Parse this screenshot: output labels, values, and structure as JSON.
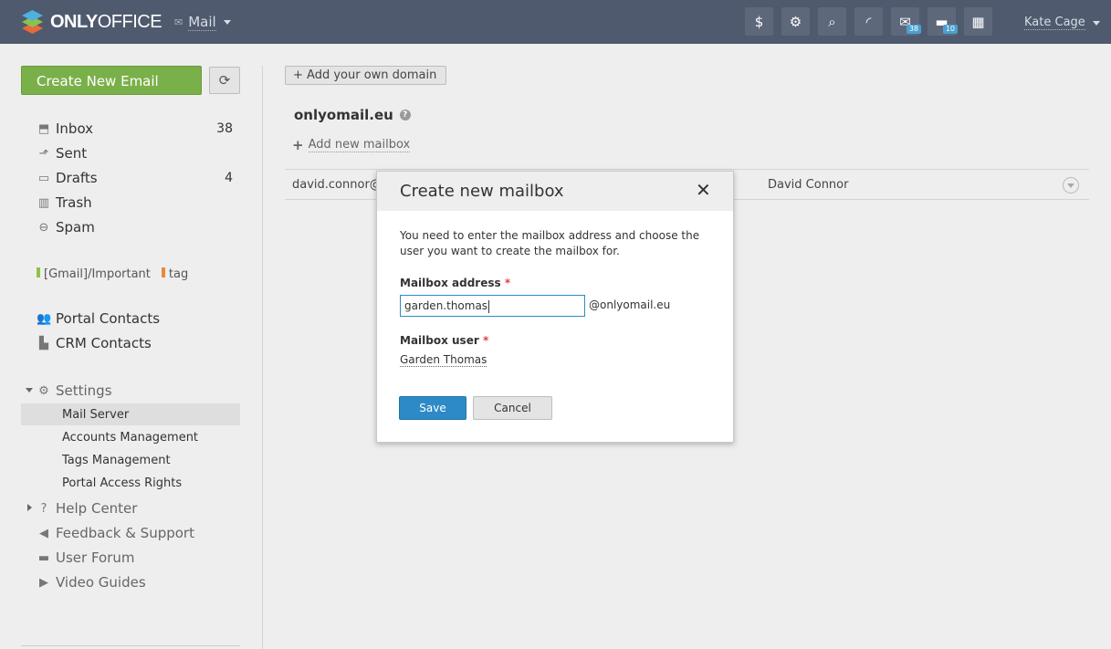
{
  "header": {
    "logo_bold": "ONLY",
    "logo_light": "OFFICE",
    "module_name": "Mail",
    "toolbar": [
      {
        "icon": "dollar-icon",
        "glyph": "$"
      },
      {
        "icon": "settings-gear-icon",
        "glyph": "⚙"
      },
      {
        "icon": "search-icon",
        "glyph": "⌕"
      },
      {
        "icon": "feed-icon",
        "glyph": "◜"
      },
      {
        "icon": "mail-icon",
        "glyph": "✉",
        "badge": "38"
      },
      {
        "icon": "chat-icon",
        "glyph": "▬",
        "badge": "10"
      },
      {
        "icon": "calendar-icon",
        "glyph": "▦"
      }
    ],
    "user_name": "Kate Cage"
  },
  "sidebar": {
    "create_label": "Create New Email",
    "folders": [
      {
        "label": "Inbox",
        "count": "38",
        "icon": "inbox-icon"
      },
      {
        "label": "Sent",
        "count": "",
        "icon": "sent-icon"
      },
      {
        "label": "Drafts",
        "count": "4",
        "icon": "drafts-icon"
      },
      {
        "label": "Trash",
        "count": "",
        "icon": "trash-icon"
      },
      {
        "label": "Spam",
        "count": "",
        "icon": "spam-icon"
      }
    ],
    "tags": [
      {
        "label": "[Gmail]/Important",
        "color": "#8bc34a"
      },
      {
        "label": "tag",
        "color": "#e8893e"
      }
    ],
    "contacts": [
      {
        "label": "Portal Contacts",
        "icon": "portal-contacts-icon"
      },
      {
        "label": "CRM Contacts",
        "icon": "crm-contacts-icon"
      }
    ],
    "settings_label": "Settings",
    "settings_items": [
      "Mail Server",
      "Accounts Management",
      "Tags Management",
      "Portal Access Rights"
    ],
    "help": [
      {
        "label": "Help Center",
        "icon": "help-center-icon"
      },
      {
        "label": "Feedback & Support",
        "icon": "megaphone-icon"
      },
      {
        "label": "User Forum",
        "icon": "forum-icon"
      },
      {
        "label": "Video Guides",
        "icon": "video-icon"
      }
    ]
  },
  "main": {
    "add_domain_label": "+ Add your own domain",
    "domain_name": "onlyomail.eu",
    "add_mailbox_label": "Add new mailbox",
    "mailbox_row": {
      "address": "david.connor@te",
      "user": "David Connor"
    }
  },
  "dialog": {
    "title": "Create new mailbox",
    "description": "You need to enter the mailbox address and choose the user you want to create the mailbox for.",
    "address_label": "Mailbox address",
    "address_value": "garden.thomas",
    "address_suffix": "@onlyomail.eu",
    "user_label": "Mailbox user",
    "user_value": "Garden Thomas",
    "save_label": "Save",
    "cancel_label": "Cancel"
  }
}
